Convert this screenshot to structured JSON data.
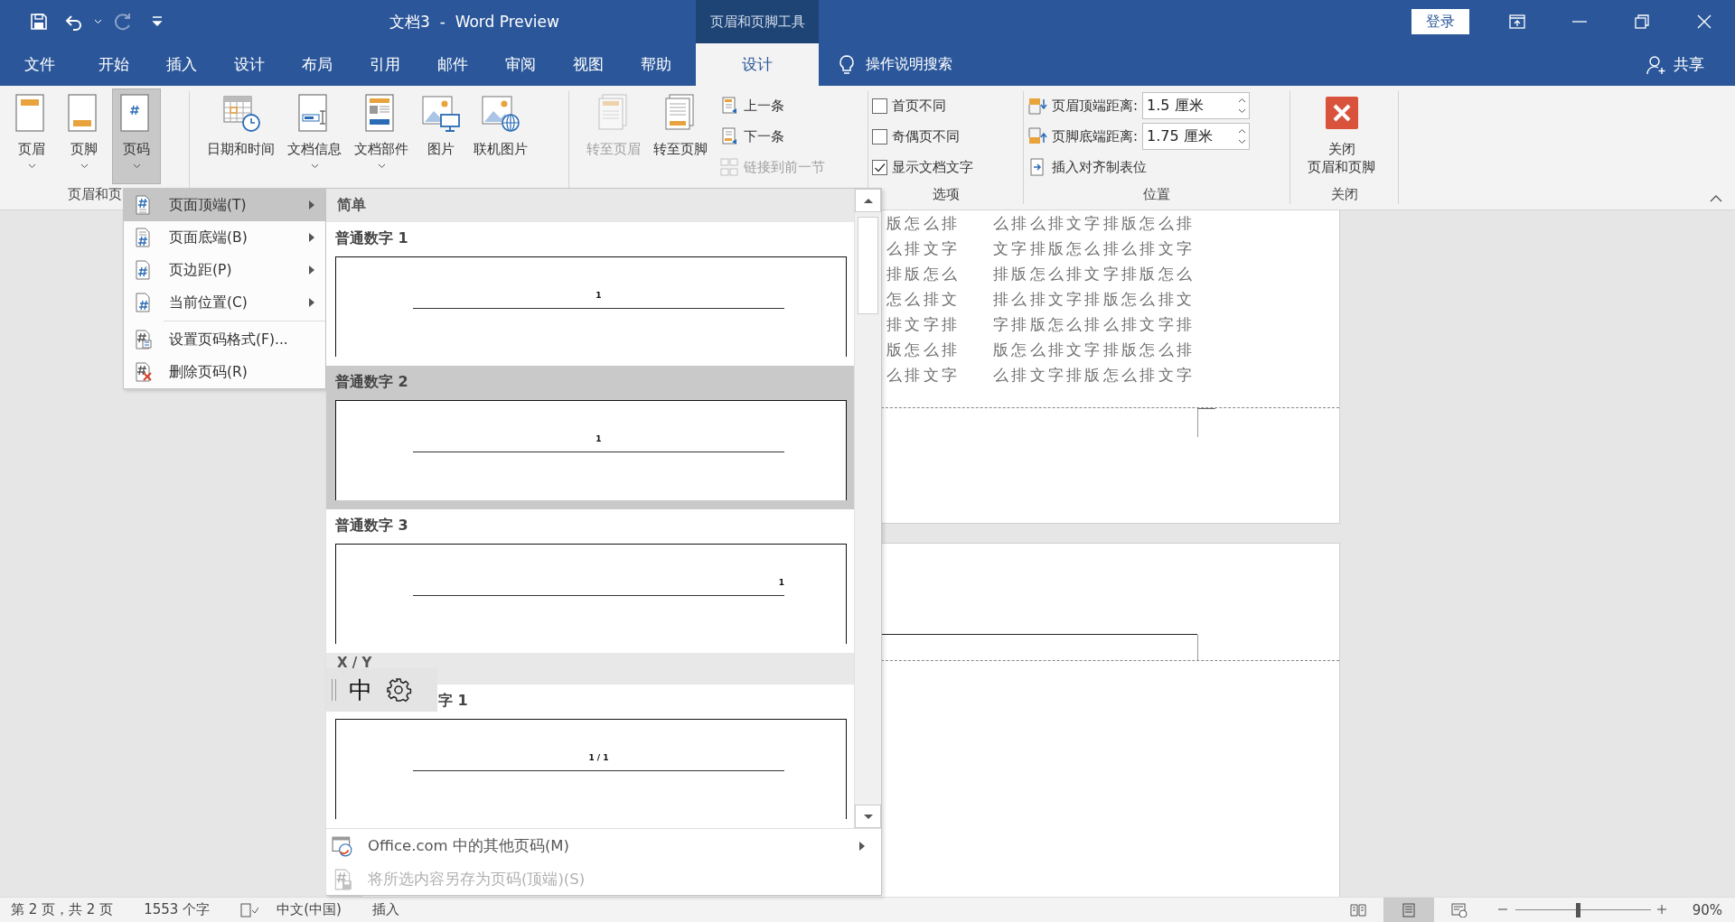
{
  "title_bar": {
    "quick_access": [
      {
        "kind": "save",
        "disabled": false
      },
      {
        "kind": "undo",
        "disabled": false
      },
      {
        "kind": "redo",
        "disabled": true
      },
      {
        "kind": "customize",
        "disabled": false
      }
    ],
    "title": "文档3  -  Word Preview",
    "context_group": "页眉和页脚工具",
    "sign_in": "登录"
  },
  "tabs": [
    {
      "label": "文件",
      "selected": false
    },
    {
      "label": "开始",
      "selected": false
    },
    {
      "label": "插入",
      "selected": false
    },
    {
      "label": "设计",
      "selected": false
    },
    {
      "label": "布局",
      "selected": false
    },
    {
      "label": "引用",
      "selected": false
    },
    {
      "label": "邮件",
      "selected": false
    },
    {
      "label": "审阅",
      "selected": false
    },
    {
      "label": "视图",
      "selected": false
    },
    {
      "label": "帮助",
      "selected": false
    },
    {
      "label": "设计",
      "selected": true
    }
  ],
  "tell_me": "操作说明搜索",
  "share": "共享",
  "ribbon": {
    "groups": [
      {
        "label": "页眉和页",
        "items": [
          {
            "kind": "large",
            "label": "页眉",
            "dropdown": true,
            "pressed": false,
            "disabled": false
          },
          {
            "kind": "large",
            "label": "页脚",
            "dropdown": true,
            "pressed": false,
            "disabled": false
          },
          {
            "kind": "large",
            "label": "页码",
            "dropdown": true,
            "pressed": true,
            "disabled": false
          }
        ]
      },
      {
        "items": [
          {
            "kind": "large",
            "label": "日期和时间",
            "dropdown": false,
            "pressed": false,
            "disabled": false
          },
          {
            "kind": "large",
            "label": "文档信息",
            "dropdown": true,
            "pressed": false,
            "disabled": false
          },
          {
            "kind": "large",
            "label": "文档部件",
            "dropdown": true,
            "pressed": false,
            "disabled": false
          },
          {
            "kind": "large",
            "label": "图片",
            "dropdown": false,
            "pressed": false,
            "disabled": false
          },
          {
            "kind": "large",
            "label": "联机图片",
            "dropdown": false,
            "pressed": false,
            "disabled": false
          }
        ]
      },
      {
        "items": [
          {
            "kind": "large",
            "label": "转至页眉",
            "dropdown": false,
            "pressed": false,
            "disabled": true
          },
          {
            "kind": "large",
            "label": "转至页脚",
            "dropdown": false,
            "pressed": false,
            "disabled": false
          },
          {
            "kind": "small",
            "label": "上一条",
            "disabled": false
          },
          {
            "kind": "small",
            "label": "下一条",
            "disabled": false
          },
          {
            "kind": "small",
            "label": "链接到前一节",
            "disabled": true
          }
        ]
      },
      {
        "label": "选项",
        "items": [
          {
            "kind": "checkbox",
            "label": "首页不同",
            "checked": false
          },
          {
            "kind": "checkbox",
            "label": "奇偶页不同",
            "checked": false
          },
          {
            "kind": "checkbox",
            "label": "显示文档文字",
            "checked": true
          }
        ]
      },
      {
        "label": "位置",
        "items": [
          {
            "kind": "spinner",
            "label": "页眉顶端距离:",
            "value": "1.5 厘米"
          },
          {
            "kind": "spinner",
            "label": "页脚底端距离:",
            "value": "1.75 厘米"
          },
          {
            "kind": "small",
            "label": "插入对齐制表位",
            "disabled": false
          }
        ]
      },
      {
        "label": "关闭",
        "items": [
          {
            "kind": "large",
            "lines": [
              "关闭",
              "页眉和页脚"
            ],
            "dropdown": false,
            "pressed": false,
            "disabled": false
          }
        ]
      }
    ]
  },
  "document": {
    "lines": [
      {
        "left": "版怎么排",
        "right": "么排么排文字排版怎么排"
      },
      {
        "left": "么排文字",
        "right": "文字排版怎么排么排文字"
      },
      {
        "left": "排版怎么",
        "right": "排版怎么排文字排版怎么"
      },
      {
        "left": "怎么排文",
        "right": "排么排文字排版怎么排文"
      },
      {
        "left": "排文字排",
        "right": "字排版怎么排么排文字排"
      },
      {
        "left": "版怎么排",
        "right": "版怎么排文字排版怎么排"
      },
      {
        "left": "么排文字",
        "right": "么排文字排版怎么排文字"
      }
    ]
  },
  "menu": {
    "items": [
      {
        "kind": "item",
        "label": "页面顶端(T)",
        "submenu": true,
        "selected": true
      },
      {
        "kind": "item",
        "label": "页面底端(B)",
        "submenu": true,
        "selected": false
      },
      {
        "kind": "item",
        "label": "页边距(P)",
        "submenu": true,
        "selected": false
      },
      {
        "kind": "item",
        "label": "当前位置(C)",
        "submenu": true,
        "selected": false
      },
      {
        "kind": "separator"
      },
      {
        "kind": "item",
        "label": "设置页码格式(F)...",
        "submenu": false,
        "selected": false
      },
      {
        "kind": "item",
        "label": "删除页码(R)",
        "submenu": false,
        "selected": false
      }
    ]
  },
  "gallery": {
    "sections": [
      {
        "heading": "简单",
        "items": [
          {
            "kind": "center",
            "label": "普通数字 1",
            "preview": "1",
            "selected": false
          },
          {
            "kind": "center",
            "label": "普通数字 2",
            "preview": "1",
            "selected": true
          },
          {
            "kind": "right",
            "label": "普通数字 3",
            "preview": "1",
            "selected": false
          }
        ]
      },
      {
        "heading": "X / Y",
        "items": [
          {
            "kind": "center",
            "label": "字 1",
            "preview": "1 / 1",
            "selected": false
          }
        ]
      }
    ],
    "footer": [
      {
        "label": "Office.com 中的其他页码(M)",
        "submenu": true,
        "disabled": false
      },
      {
        "label": "将所选内容另存为页码(顶端)(S)",
        "submenu": false,
        "disabled": true
      }
    ]
  },
  "ime_bar": {
    "mode": "中"
  },
  "status_bar": {
    "page": "第 2 页，共 2 页",
    "word_count": "1553 个字",
    "language": "中文(中国)",
    "input_mode": "插入",
    "views": [
      {
        "kind": "read",
        "selected": false
      },
      {
        "kind": "print",
        "selected": true
      },
      {
        "kind": "web",
        "selected": false
      }
    ],
    "zoom": {
      "level": 0.46,
      "value": "90%"
    }
  }
}
